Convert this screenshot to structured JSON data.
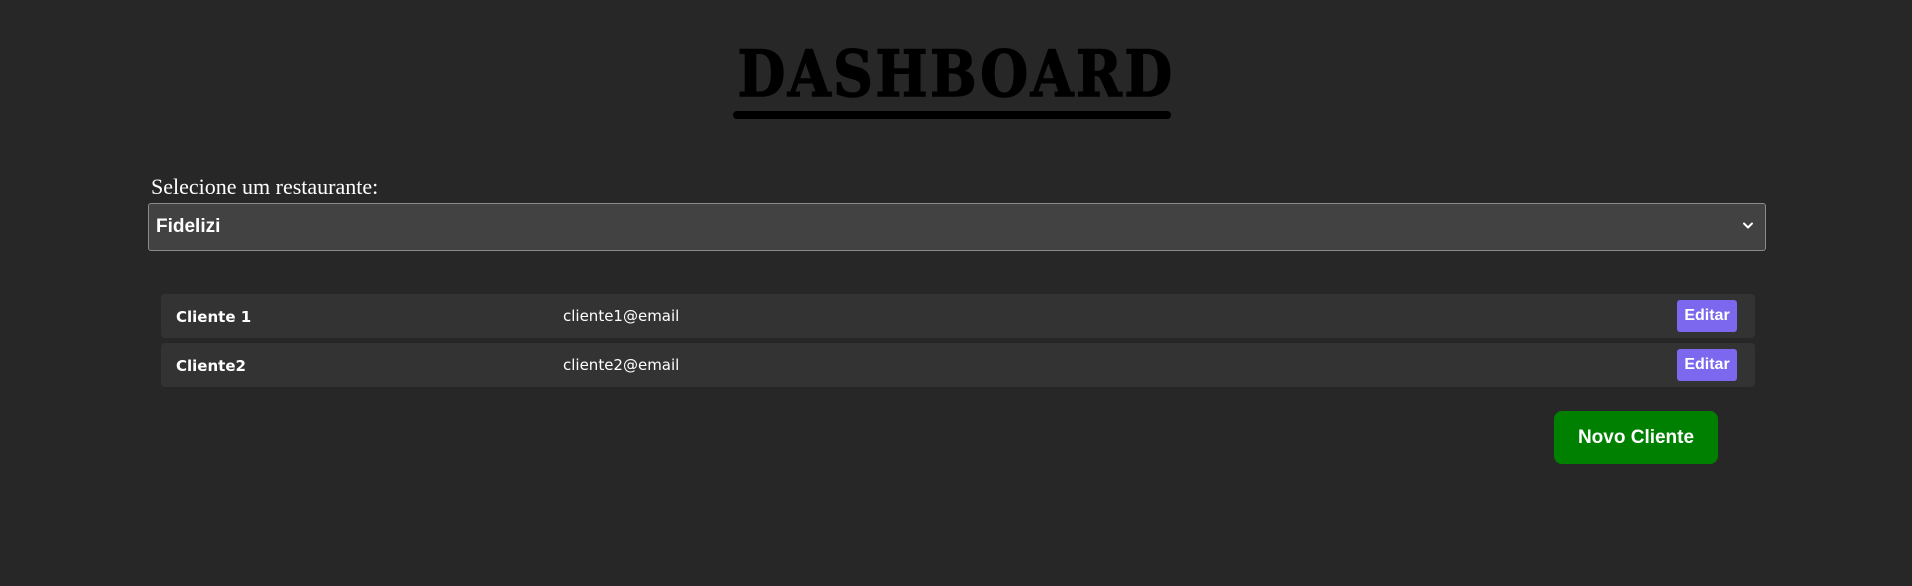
{
  "header": {
    "title": "DASHBOARD"
  },
  "restaurant_select": {
    "label": "Selecione um restaurante:",
    "selected": "Fidelizi",
    "icon": "chevron-down-icon"
  },
  "clients": [
    {
      "name": "Cliente 1",
      "email": "cliente1@email",
      "edit_label": "Editar"
    },
    {
      "name": "Cliente2",
      "email": "cliente2@email",
      "edit_label": "Editar"
    }
  ],
  "actions": {
    "new_client_label": "Novo Cliente"
  },
  "colors": {
    "background": "#272727",
    "select_background": "#424242",
    "row_background": "#333333",
    "edit_button": "#7b68ee",
    "new_client_button": "#008000"
  }
}
